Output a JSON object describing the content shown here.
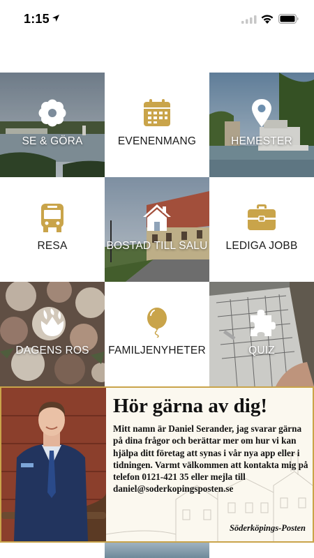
{
  "status_bar": {
    "time": "1:15"
  },
  "grid": {
    "tiles": [
      {
        "label": "SE & GÖRA",
        "icon": "flower-icon",
        "style": "photo"
      },
      {
        "label": "EVENENMANG",
        "icon": "calendar-icon",
        "style": "white"
      },
      {
        "label": "HEMESTER",
        "icon": "map-pin-icon",
        "style": "photo"
      },
      {
        "label": "RESA",
        "icon": "bus-icon",
        "style": "white"
      },
      {
        "label": "BOSTAD TILL SALU",
        "icon": "house-icon",
        "style": "photo"
      },
      {
        "label": "LEDIGA JOBB",
        "icon": "briefcase-icon",
        "style": "white"
      },
      {
        "label": "DAGENS ROS",
        "icon": "rose-icon",
        "style": "photo"
      },
      {
        "label": "FAMILJENYHETER",
        "icon": "balloon-icon",
        "style": "white"
      },
      {
        "label": "QUIZ",
        "icon": "puzzle-icon",
        "style": "photo"
      }
    ]
  },
  "banner": {
    "heading": "Hör gärna av dig!",
    "body": "Mitt namn är Daniel Serander, jag svarar gärna på dina frågor och berättar mer om hur vi kan hjälpa ditt företag att synas i vår nya app eller i tidningen. Varmt välkommen att kontakta mig på telefon 0121-421 35 eller mejla till daniel@soderkopingsposten.se",
    "brand": "Söderköpings-Posten"
  },
  "colors": {
    "accent_gold": "#c9a44a",
    "label_dark": "#1a1a1a",
    "banner_bg": "#fbf8ef"
  }
}
